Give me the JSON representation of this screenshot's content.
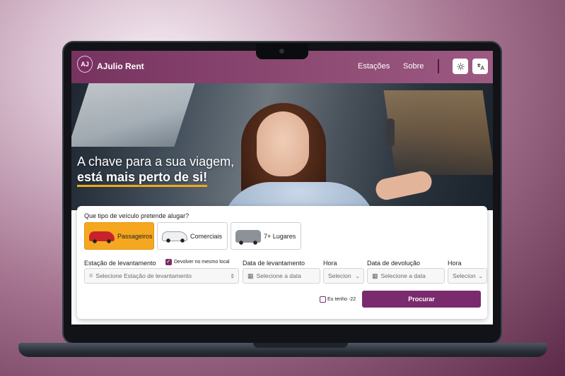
{
  "navbar": {
    "logo_text": "AJ",
    "brand": "AJulio Rent",
    "links": [
      "Estações",
      "Sobre"
    ]
  },
  "hero": {
    "headline_line1": "A chave para a sua viagem,",
    "headline_line2": "está mais perto de si!"
  },
  "booking": {
    "question": "Que tipo de veículo pretende alugar?",
    "vehicle_types": [
      {
        "label": "Passageiros",
        "selected": true
      },
      {
        "label": "Comerciais",
        "selected": false
      },
      {
        "label": "7+ Lugares",
        "selected": false
      }
    ],
    "pickup_station_label": "Estação de levantamento",
    "return_same_label": "Devolver no mesmo local",
    "return_same_checked": true,
    "pickup_station_placeholder": "Selecione Estação de levantamento",
    "pickup_date_label": "Data de levantamento",
    "pickup_date_placeholder": "Selecione a data",
    "pickup_hour_label": "Hora",
    "pickup_hour_placeholder": "Selecion",
    "return_date_label": "Data de devolução",
    "return_date_placeholder": "Selecione a data",
    "return_hour_label": "Hora",
    "return_hour_placeholder": "Selecion",
    "age_checkbox_label": "Eu tenho -22",
    "age_checked": false,
    "search_button": "Procurar"
  },
  "colors": {
    "navbar": "#8d4a73",
    "accent_orange": "#f5a71f",
    "primary_purple": "#7a2b6e"
  },
  "icons": {
    "theme": "sun-icon",
    "language": "translate-icon",
    "location": "map-pin-icon",
    "calendar": "calendar-icon"
  }
}
